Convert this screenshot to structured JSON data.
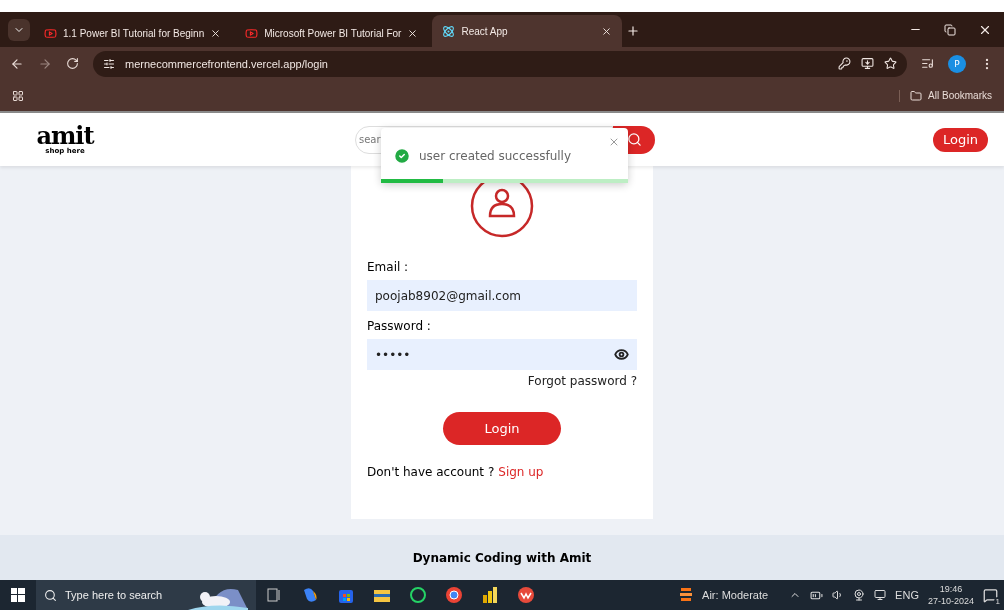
{
  "browser": {
    "tabs": [
      {
        "title": "1.1 Power BI Tutorial for Beginn",
        "kind": "video",
        "selected": false
      },
      {
        "title": "Microsoft Power BI Tutorial For",
        "kind": "video",
        "selected": false
      },
      {
        "title": "React App",
        "kind": "react",
        "selected": true
      }
    ],
    "url": "mernecommercefrontend.vercel.app/login",
    "profile": "P",
    "bookmarks": "All Bookmarks"
  },
  "header": {
    "logo": "amit",
    "tagline": "shop here",
    "search_placeholder": "sear",
    "login": "Login"
  },
  "toast": {
    "message": "user created successfully",
    "level": 0.25
  },
  "form": {
    "email_label": "Email :",
    "email": "poojab8902@gmail.com",
    "password_label": "Password :",
    "password": "•••••",
    "forgot": "Forgot password ?",
    "submit": "Login",
    "signup_prompt": "Don't have account ?",
    "signup_link": "Sign up"
  },
  "footer": "Dynamic Coding with Amit",
  "taskbar": {
    "search_placeholder": "Type here to search",
    "apps": [
      {
        "kind": "taskview"
      },
      {
        "kind": "copilot"
      },
      {
        "kind": "store"
      },
      {
        "kind": "files"
      },
      {
        "kind": "whatsapp"
      },
      {
        "kind": "chrome"
      },
      {
        "kind": "powerbi"
      },
      {
        "kind": "wps"
      }
    ],
    "weather": "Air: Moderate",
    "language": "ENG",
    "time": "19:46",
    "date": "27-10-2024",
    "notifications": "1"
  }
}
